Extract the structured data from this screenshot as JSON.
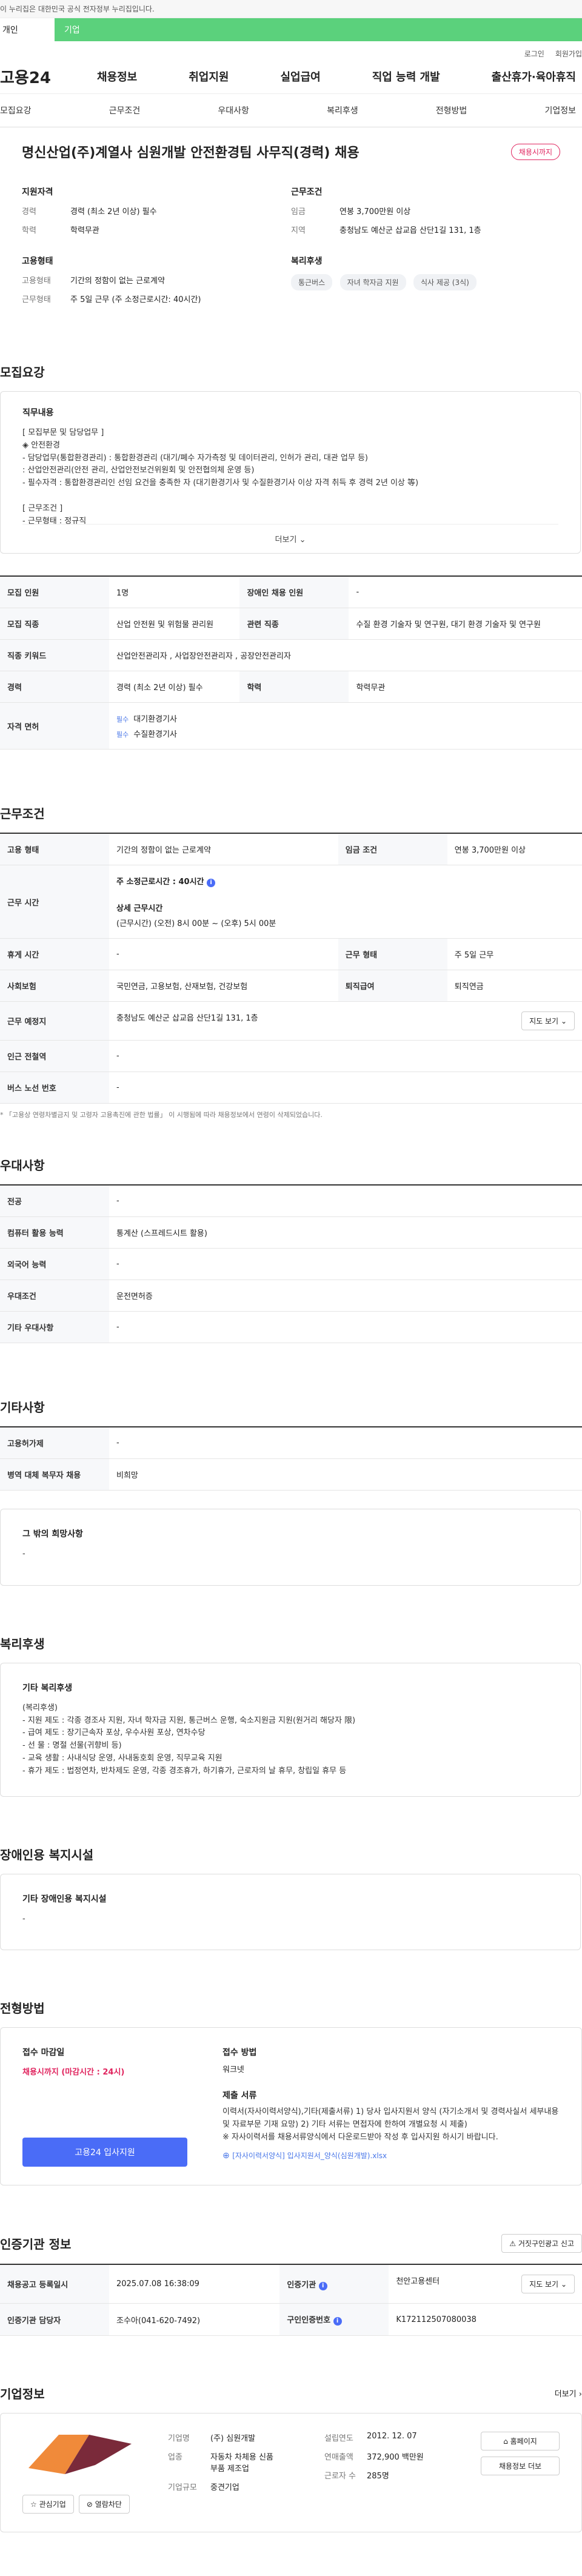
{
  "gov_bar": "이 누리집은 대한민국 공식 전자정부 누리집입니다.",
  "top_tabs": {
    "person": "개인",
    "company": "기업"
  },
  "util": {
    "login": "로그인",
    "join": "회원가입"
  },
  "gnb": {
    "logo": "고용24",
    "menu": [
      "채용정보",
      "취업지원",
      "실업급여",
      "직업 능력 개발",
      "출산휴가·육아휴직"
    ]
  },
  "sub_nav": [
    "모집요강",
    "근무조건",
    "우대사항",
    "복리후생",
    "전형방법",
    "기업정보"
  ],
  "hero": {
    "title": "명신산업(주)계열사 심원개발 안전환경팀 사무직(경력) 채용",
    "badge": "채용시까지",
    "qual_title": "지원자격",
    "qual": [
      {
        "k": "경력",
        "v": "경력 (최소 2년 이상) 필수"
      },
      {
        "k": "학력",
        "v": "학력무관"
      }
    ],
    "work_title": "근무조건",
    "work": [
      {
        "k": "임금",
        "v": "연봉 3,700만원 이상"
      },
      {
        "k": "지역",
        "v": "충청남도 예산군 삽교읍 산단1길 131, 1층"
      }
    ],
    "emp_title": "고용형태",
    "emp": [
      {
        "k": "고용형태",
        "v": "기간의 정함이 없는 근로계약"
      },
      {
        "k": "근무형태",
        "v": "주 5일 근무 (주 소정근로시간: 40시간)"
      }
    ],
    "welfare_title": "복리후생",
    "welfare_chips": [
      "통근버스",
      "자녀 학자금 지원",
      "식사 제공 (3식)"
    ]
  },
  "recruit": {
    "section": "모집요강",
    "box_title": "직무내용",
    "text": "[ 모집부문 및 담당업무 ]\n ◈ 안전환경\n   - 담당업무(통합환경관리) : 통합환경관리 (대기/폐수 자가측정 및 데이터관리, 인허가 관리, 대관 업무 등)\n                                              : 산업안전관리(안전 관리, 산업안전보건위원회 및 안전협의체 운영 등)\n   - 필수자격 : 통합환경관리인 선임 요건을 충족한 자 (대기환경기사 및 수질환경기사 이상 자격 취득 후 경력 2년 이상 等)\n\n[ 근무조건 ]\n  - 근무형태 : 정규직\n  - 급       여 : 회사 내규",
    "more": "더보기",
    "rows": [
      [
        {
          "h": "모집 인원",
          "v": "1명"
        },
        {
          "h": "장애인 채용 인원",
          "v": "-"
        }
      ],
      [
        {
          "h": "모집 직종",
          "v": "산업 안전원 및 위험물 관리원"
        },
        {
          "h": "관련 직종",
          "v": "수질 환경 기술자 및 연구원, 대기 환경 기술자 및 연구원"
        }
      ],
      [
        {
          "h": "직종 키워드",
          "v": "산업안전관리자 , 사업장안전관리자 , 공장안전관리자"
        }
      ],
      [
        {
          "h": "경력",
          "v": "경력 (최소 2년 이상) 필수"
        },
        {
          "h": "학력",
          "v": "학력무관"
        }
      ]
    ],
    "license_h": "자격 면허",
    "licenses": [
      {
        "tag": "필수",
        "name": "대기환경기사"
      },
      {
        "tag": "필수",
        "name": "수질환경기사"
      }
    ]
  },
  "work_cond": {
    "section": "근무조건",
    "emp_type_h": "고용 형태",
    "emp_type": "기간의 정함이 없는 근로계약",
    "wage_h": "임금 조건",
    "wage": "연봉 3,700만원 이상",
    "hours_h": "근무 시간",
    "hours_main": "주 소정근로시간 : 40시간",
    "hours_detail_title": "상세 근무시간",
    "hours_detail": "(근무시간) (오전) 8시 00분 ~ (오후) 5시 00분",
    "rest_h": "휴게 시간",
    "rest": "-",
    "work_form_h": "근무 형태",
    "work_form": "주 5일 근무",
    "insurance_h": "사회보험",
    "insurance": "국민연금, 고용보험, 산재보험, 건강보험",
    "retire_h": "퇴직급여",
    "retire": "퇴직연금",
    "place_h": "근무 예정지",
    "place": "충청남도 예산군 삽교읍 산단1길 131, 1층",
    "map_btn": "지도 보기",
    "station_h": "인근 전철역",
    "station": "-",
    "bus_h": "버스 노선 번호",
    "bus": "-",
    "note": "* 「고용상 연령차별금지 및 고령자 고용촉진에 관한 법률」 이 시행됨에 따라 채용정보에서 연령이 삭제되었습니다."
  },
  "preference": {
    "section": "우대사항",
    "rows": [
      {
        "h": "전공",
        "v": "-"
      },
      {
        "h": "컴퓨터 활용 능력",
        "v": "통계산 (스프레드시트 활용)"
      },
      {
        "h": "외국어 능력",
        "v": "-"
      },
      {
        "h": "우대조건",
        "v": "운전면허증"
      },
      {
        "h": "기타 우대사항",
        "v": "-"
      }
    ]
  },
  "etc": {
    "section": "기타사항",
    "rows": [
      {
        "h": "고용허가제",
        "v": "-"
      },
      {
        "h": "병역 대체 복무자 채용",
        "v": "비희망"
      }
    ],
    "hope_title": "그 밖의 희망사항",
    "hope": "-"
  },
  "welfare": {
    "section": "복리후생",
    "box_title": "기타 복리후생",
    "text": "(복리후생)\n - 지원 제도 : 각종 경조사 지원, 자녀 학자금 지원, 통근버스 운행, 숙소지원금 지원(원거리 해당자 限)\n - 급여 제도 : 장기근속자 포상, 우수사원 포상, 연차수당\n - 선       물 : 명절 선물(귀향비 등)\n - 교육 생활 : 사내식당 운영, 사내동호회 운영, 직무교육 지원\n - 휴가 제도 : 법정연차, 반차제도 운영, 각종 경조휴가, 하기휴가, 근로자의 날 휴무, 창립일 휴무 등"
  },
  "disabled": {
    "section": "장애인용 복지시설",
    "box_title": "기타 장애인용 복지시설",
    "value": "-"
  },
  "process": {
    "section": "전형방법",
    "deadline_title": "접수 마감일",
    "deadline": "채용시까지 (마감시간 : 24시)",
    "method_title": "접수 방법",
    "method": "워크넷",
    "docs_title": "제출 서류",
    "docs": "이력서(자사이력서양식),기타(제출서류) 1) 당사 입사지원서 양식 (자기소개서 및 경력사실서 세부내용 및 자료부문 기재 요망) 2) 기타 서류는 면접자에 한하여 개별요청 시 제출)\n※ 자사이력서를 채용서류양식에서 다운로드받아 작성 후 입사지원 하시기 바랍니다.",
    "file": "[자사이력서양식] 입사지원서_양식(심원개발).xlsx",
    "apply_btn": "고용24 입사지원"
  },
  "cert": {
    "section": "인증기관 정보",
    "report_btn": "거짓구인광고 신고",
    "reg_h": "채용공고 등록일시",
    "reg": "2025.07.08 16:38:09",
    "org_h": "인증기관",
    "org": "천안고용센터",
    "map_btn": "지도 보기",
    "manager_h": "인증기관 담당자",
    "manager": "조수아(041-620-7492)",
    "num_h": "구인인증번호",
    "num": "K172112507080038"
  },
  "company": {
    "section": "기업정보",
    "more": "더보기",
    "interest_btn": "관심기업",
    "block_btn": "열람차단",
    "fields": [
      {
        "k": "기업명",
        "v": "(주) 심원개발"
      },
      {
        "k": "업종",
        "v": "자동차 차체용 신품 부품 제조업"
      },
      {
        "k": "기업규모",
        "v": "중견기업"
      }
    ],
    "fields2": [
      {
        "k": "설립연도",
        "v": "2012. 12. 07"
      },
      {
        "k": "연매출액",
        "v": "372,900 백만원"
      },
      {
        "k": "근로자 수",
        "v": "285명"
      }
    ],
    "homepage_btn": "홈페이지",
    "more_jobs_btn": "채용정보 더보"
  },
  "colors": {
    "accent": "#4a6cf7",
    "green": "#5bd17c",
    "red": "#e0245e"
  }
}
